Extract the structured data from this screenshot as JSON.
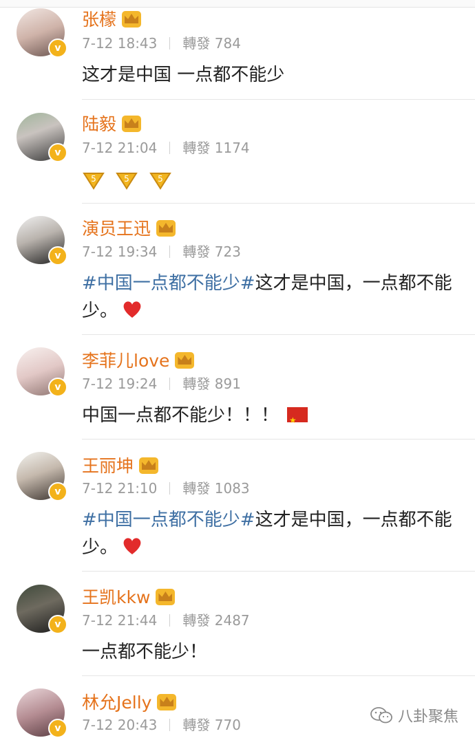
{
  "posts": [
    {
      "name": "张檬",
      "time": "7-12 18:43",
      "repost_label": "轉發",
      "repost_count": "784",
      "text": "这才是中国  一点都不能少"
    },
    {
      "name": "陆毅",
      "time": "7-12 21:04",
      "repost_label": "轉發",
      "repost_count": "1174",
      "emoji": [
        "coin",
        "coin",
        "coin"
      ]
    },
    {
      "name": "演员王迅",
      "time": "7-12 19:34",
      "repost_label": "轉發",
      "repost_count": "723",
      "hashtag": "#中国一点都不能少#",
      "text": "这才是中国，一点都不能少。",
      "emoji_end": "heart"
    },
    {
      "name": "李菲儿love",
      "time": "7-12 19:24",
      "repost_label": "轉發",
      "repost_count": "891",
      "text": "中国一点都不能少！！！",
      "emoji_end": "china-flag"
    },
    {
      "name": "王丽坤",
      "time": "7-12 21:10",
      "repost_label": "轉發",
      "repost_count": "1083",
      "hashtag": "#中国一点都不能少#",
      "text": "这才是中国，一点都不能少。",
      "emoji_end": "heart"
    },
    {
      "name": "王凯kkw",
      "time": "7-12 21:44",
      "repost_label": "轉發",
      "repost_count": "2487",
      "text": "一点都不能少！"
    },
    {
      "name": "林允Jelly",
      "time": "7-12 20:43",
      "repost_label": "轉發",
      "repost_count": "770"
    }
  ],
  "watermark": "八卦聚焦",
  "colors": {
    "name": "#e5731c",
    "hashtag": "#3e6fa3",
    "verified": "#f3b21b",
    "meta": "#9a9a9a"
  }
}
